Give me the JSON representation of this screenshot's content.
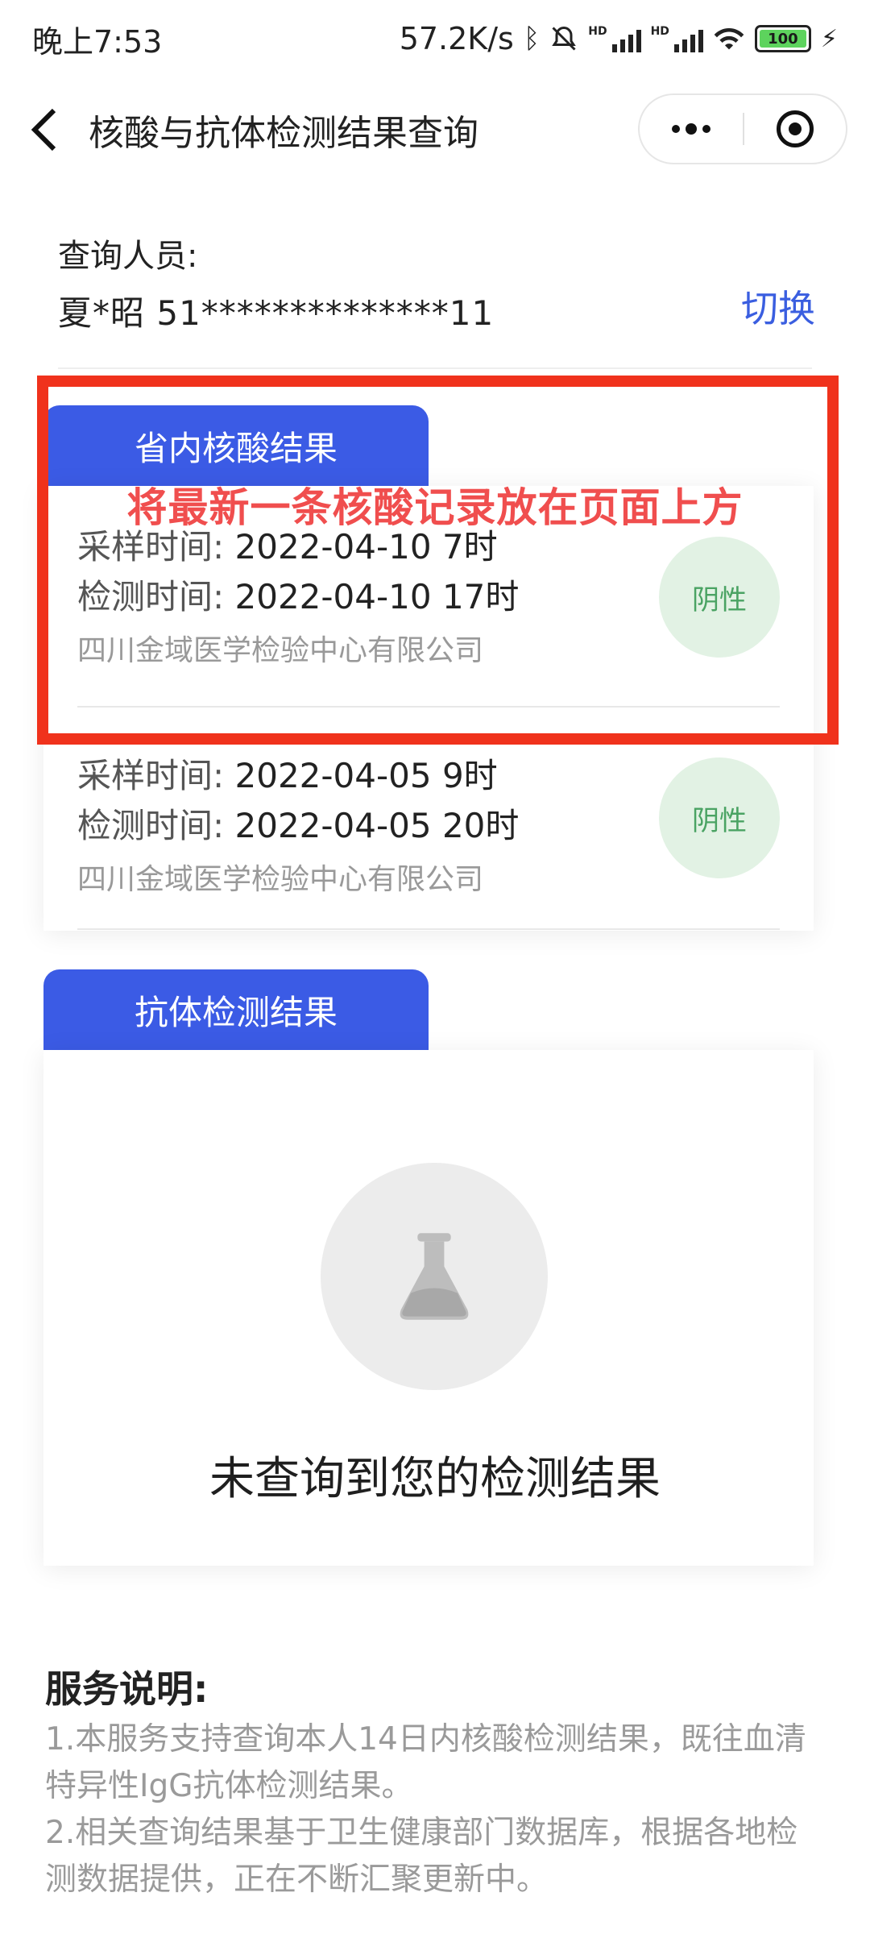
{
  "status_bar": {
    "time": "晚上7:53",
    "speed": "57.2K/s",
    "battery": "100"
  },
  "nav": {
    "title": "核酸与抗体检测结果查询"
  },
  "person": {
    "label": "查询人员:",
    "value": "夏*昭 51**************11",
    "switch_label": "切换"
  },
  "nucleic": {
    "tab_label": "省内核酸结果",
    "records": [
      {
        "sample_key": "采样时间:",
        "sample_val": "2022-04-10 7时",
        "test_key": "检测时间:",
        "test_val": "2022-04-10 17时",
        "org": "四川金域医学检验中心有限公司",
        "result": "阴性"
      },
      {
        "sample_key": "采样时间:",
        "sample_val": "2022-04-05 9时",
        "test_key": "检测时间:",
        "test_val": "2022-04-05 20时",
        "org": "四川金域医学检验中心有限公司",
        "result": "阴性"
      }
    ]
  },
  "annotation": {
    "text": "将最新一条核酸记录放在页面上方",
    "color": "#f0321c"
  },
  "antibody": {
    "tab_label": "抗体检测结果",
    "empty_text": "未查询到您的检测结果"
  },
  "service": {
    "title": "服务说明:",
    "items": [
      "1.本服务支持查询本人14日内核酸检测结果，既往血清特异性IgG抗体检测结果。",
      "2.相关查询结果基于卫生健康部门数据库，根据各地检测数据提供，正在不断汇聚更新中。"
    ]
  },
  "colors": {
    "accent": "#3b5be5",
    "switch": "#3a5ee0",
    "negative_bg": "#e2f2e4",
    "negative_text": "#4aa363"
  }
}
